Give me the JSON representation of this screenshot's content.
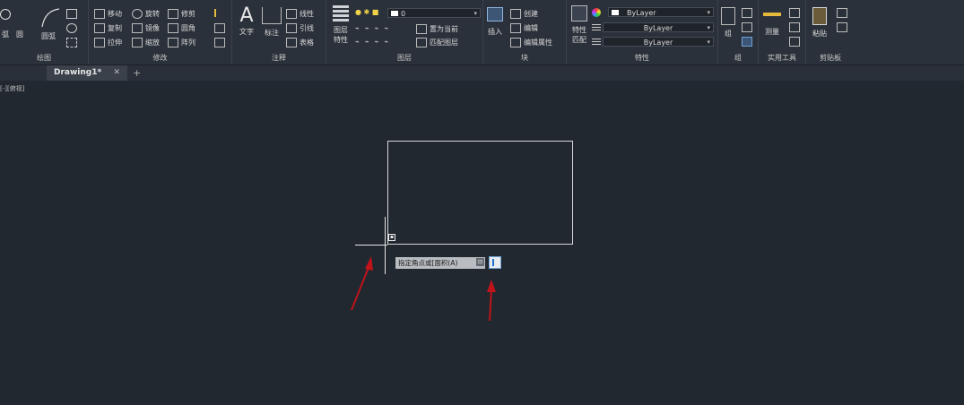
{
  "ribbon": {
    "panels": {
      "draw": "绘图",
      "modify": "修改",
      "annotation": "注释",
      "layers": "图层",
      "block": "块",
      "properties": "特性",
      "groups": "组",
      "utilities": "实用工具",
      "clipboard": "剪贴板"
    },
    "draw": {
      "circle": "圆",
      "arc": "圆弧",
      "arc_small": "弧"
    },
    "modify": {
      "move": "移动",
      "rotate": "旋转",
      "trim": "修剪",
      "copy": "复制",
      "mirror": "镜像",
      "fillet": "圆角",
      "stretch": "拉伸",
      "scale": "缩放",
      "array": "阵列"
    },
    "annotation": {
      "text": "文字",
      "dimension": "标注",
      "linear": "线性",
      "leader": "引线",
      "table": "表格"
    },
    "layers": {
      "layer_properties": "图层\n特性",
      "layer_current": "0",
      "make_current": "置为当前",
      "match_layer": "匹配图层"
    },
    "block": {
      "insert": "插入",
      "create": "创建",
      "edit": "编辑",
      "edit_attributes": "编辑属性"
    },
    "properties": {
      "match": "特性\n匹配",
      "color": "ByLayer",
      "linetype": "ByLayer",
      "lineweight": "ByLayer"
    },
    "groups": {
      "group": "组"
    },
    "utilities": {
      "measure": "测量"
    },
    "clipboard": {
      "paste": "粘贴"
    }
  },
  "tabs": [
    {
      "label": "Drawing1*",
      "close": "✕"
    }
  ],
  "new_tab_symbol": "+",
  "viewport_label": "[-][俯视]",
  "canvas": {
    "prompt_text": "指定角点或[面积(A)",
    "prompt_icon": "⊡"
  },
  "colors": {
    "background": "#212830",
    "ribbon": "#2b313a",
    "annotation_arrow": "#c0131a",
    "input_border": "#6fa2d8"
  }
}
